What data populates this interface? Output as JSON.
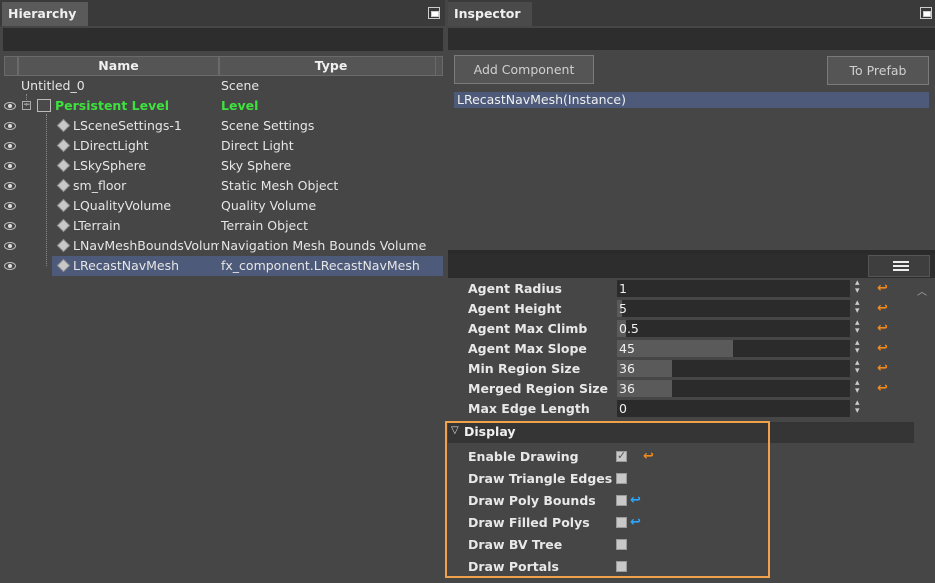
{
  "hierarchy": {
    "tab_label": "Hierarchy",
    "columns": {
      "name": "Name",
      "type": "Type"
    },
    "rows": [
      {
        "name": "Untitled_0",
        "type": "Scene"
      },
      {
        "name": "Persistent Level",
        "type": "Level"
      },
      {
        "name": "LSceneSettings-1",
        "type": "Scene Settings"
      },
      {
        "name": "LDirectLight",
        "type": "Direct Light"
      },
      {
        "name": "LSkySphere",
        "type": "Sky Sphere"
      },
      {
        "name": "sm_floor",
        "type": "Static Mesh Object"
      },
      {
        "name": "LQualityVolume",
        "type": "Quality Volume"
      },
      {
        "name": "LTerrain",
        "type": "Terrain Object"
      },
      {
        "name": "LNavMeshBoundsVolume",
        "type": "Navigation Mesh Bounds Volume"
      },
      {
        "name": "LRecastNavMesh",
        "type": "fx_component.LRecastNavMesh"
      }
    ]
  },
  "inspector": {
    "tab_label": "Inspector",
    "add_component_label": "Add Component",
    "to_prefab_label": "To Prefab",
    "instance_label": "LRecastNavMesh(Instance)",
    "properties": [
      {
        "label": "Agent Radius",
        "value": "1",
        "fill": 0.0
      },
      {
        "label": "Agent Height",
        "value": "5",
        "fill": 0.02
      },
      {
        "label": "Agent Max Climb",
        "value": "0.5",
        "fill": 0.05
      },
      {
        "label": "Agent Max Slope",
        "value": "45",
        "fill": 0.5
      },
      {
        "label": "Min Region Size",
        "value": "36",
        "fill": 0.24
      },
      {
        "label": "Merged Region Size",
        "value": "36",
        "fill": 0.24
      },
      {
        "label": "Max Edge Length",
        "value": "0",
        "fill": 0.0
      }
    ],
    "display_section_label": "Display",
    "display_items": [
      {
        "label": "Enable Drawing",
        "checked": true
      },
      {
        "label": "Draw Triangle Edges",
        "checked": false
      },
      {
        "label": "Draw Poly Bounds",
        "checked": false
      },
      {
        "label": "Draw Filled Polys",
        "checked": false
      },
      {
        "label": "Draw BV Tree",
        "checked": false
      },
      {
        "label": "Draw Portals",
        "checked": false
      }
    ]
  },
  "colors": {
    "highlight_border": "#f0a24a",
    "selection": "#4d5a7a",
    "level_text": "#3ee23e",
    "reset_orange": "#f08a1e",
    "reset_blue": "#2aa8ff"
  }
}
